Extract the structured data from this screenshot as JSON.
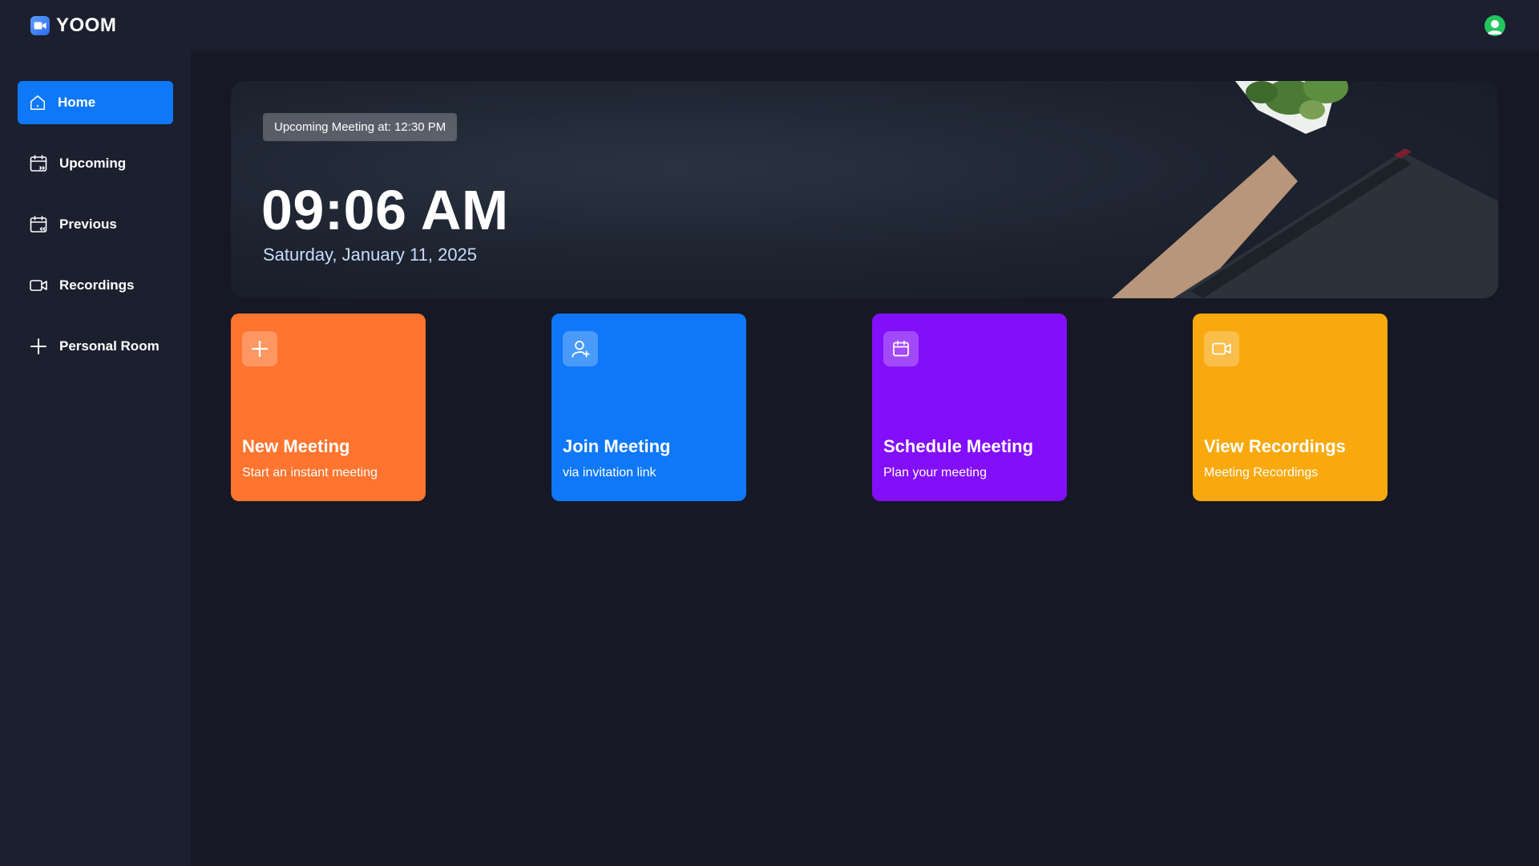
{
  "app": {
    "name": "YOOM",
    "accent": "#0e78f9"
  },
  "header": {
    "avatar_icon": "user-avatar-icon"
  },
  "sidebar": {
    "items": [
      {
        "label": "Home",
        "icon": "home-icon",
        "active": true
      },
      {
        "label": "Upcoming",
        "icon": "calendar-upcoming-icon",
        "active": false
      },
      {
        "label": "Previous",
        "icon": "calendar-previous-icon",
        "active": false
      },
      {
        "label": "Recordings",
        "icon": "video-icon",
        "active": false
      },
      {
        "label": "Personal Room",
        "icon": "plus-icon",
        "active": false
      }
    ]
  },
  "hero": {
    "badge": "Upcoming Meeting at: 12:30 PM",
    "time": "09:06 AM",
    "date": "Saturday, January 11, 2025"
  },
  "cards": [
    {
      "title": "New Meeting",
      "subtitle": "Start an instant meeting",
      "icon": "plus-icon",
      "color": "#ff742e"
    },
    {
      "title": "Join Meeting",
      "subtitle": "via invitation link",
      "icon": "add-user-icon",
      "color": "#0e78f9"
    },
    {
      "title": "Schedule Meeting",
      "subtitle": "Plan your meeting",
      "icon": "calendar-icon",
      "color": "#830ef9"
    },
    {
      "title": "View Recordings",
      "subtitle": "Meeting Recordings",
      "icon": "video-icon",
      "color": "#f9a90e"
    }
  ]
}
